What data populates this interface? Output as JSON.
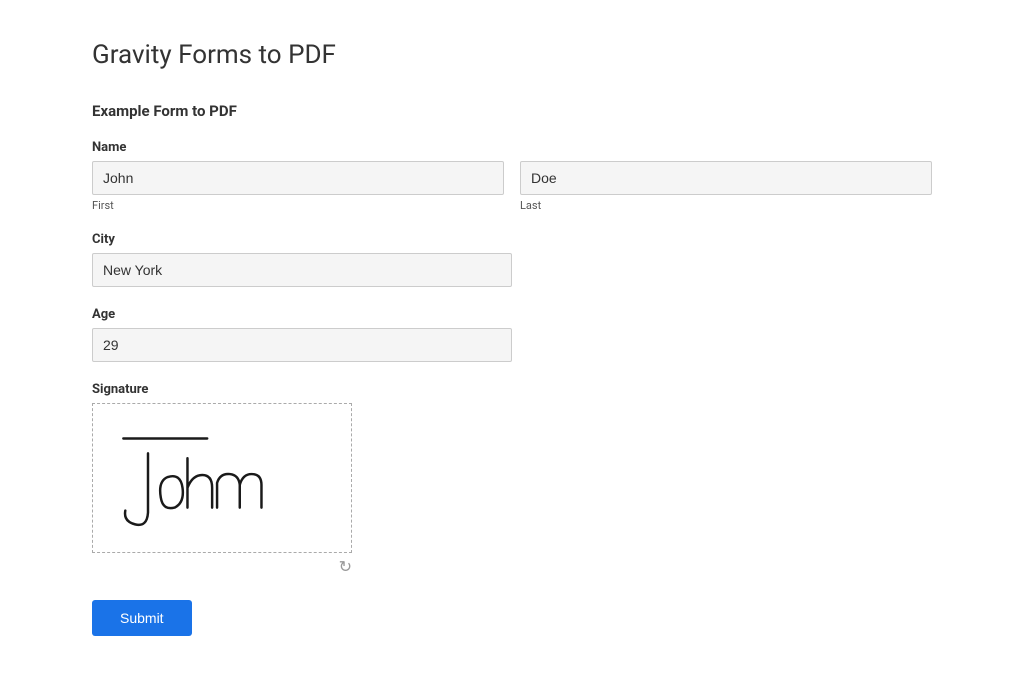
{
  "page": {
    "title": "Gravity Forms to PDF"
  },
  "form": {
    "title": "Example Form to PDF",
    "fields": {
      "name": {
        "label": "Name",
        "first": {
          "value": "John",
          "sub_label": "First"
        },
        "last": {
          "value": "Doe",
          "sub_label": "Last"
        }
      },
      "city": {
        "label": "City",
        "value": "New York",
        "placeholder": ""
      },
      "age": {
        "label": "Age",
        "value": "29",
        "placeholder": ""
      },
      "signature": {
        "label": "Signature"
      }
    },
    "submit_label": "Submit"
  }
}
